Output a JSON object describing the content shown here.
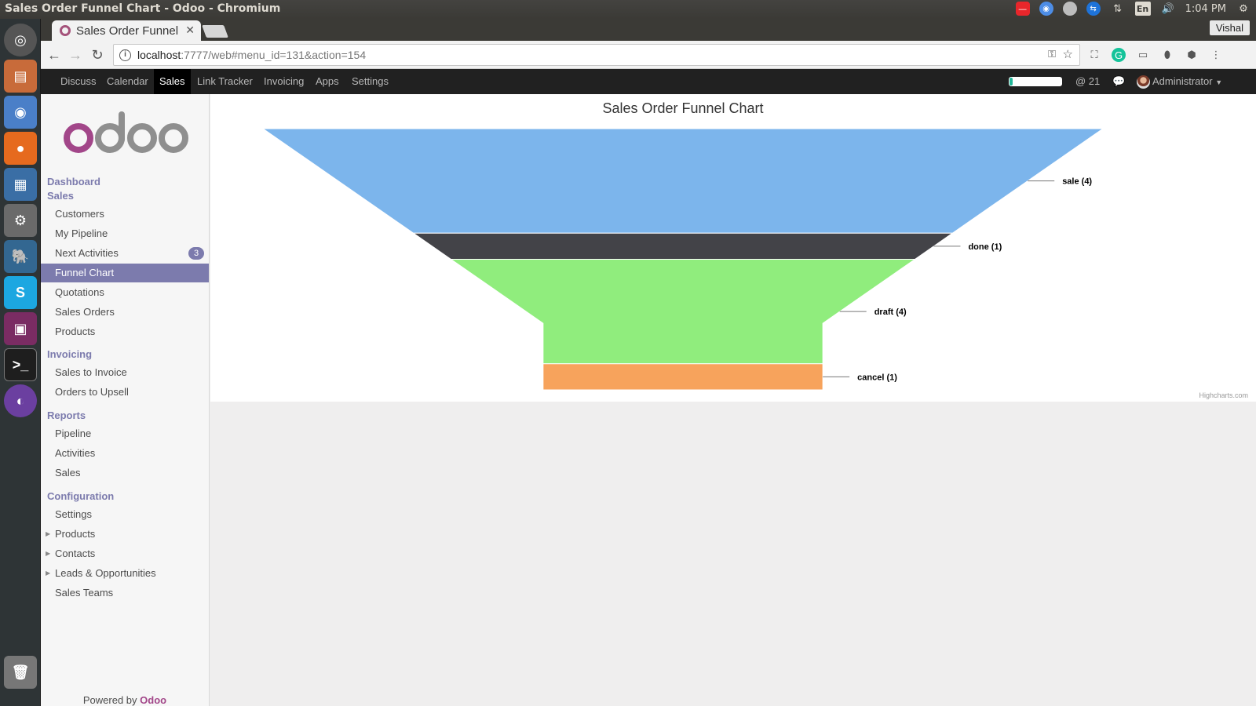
{
  "window": {
    "title": "Sales Order Funnel Chart - Odoo - Chromium"
  },
  "os_tray": {
    "lang": "En",
    "time": "1:04 PM"
  },
  "browser": {
    "tab_title": "Sales Order Funnel",
    "user": "Vishal",
    "url_host": "localhost",
    "url_path": ":7777/web#menu_id=131&action=154"
  },
  "odoo": {
    "apps": [
      "Discuss",
      "Calendar",
      "Sales",
      "Link Tracker",
      "Invoicing",
      "Apps",
      "Settings"
    ],
    "active_app": "Sales",
    "onboarding_progress_fraction": 0.06,
    "mentions": "@ 21",
    "user": "Administrator",
    "logo_text": "odoo",
    "sidebar": {
      "sections": [
        {
          "label": "Dashboard",
          "items": []
        },
        {
          "label": "Sales",
          "items": [
            {
              "label": "Customers"
            },
            {
              "label": "My Pipeline"
            },
            {
              "label": "Next Activities",
              "badge": "3"
            },
            {
              "label": "Funnel Chart",
              "active": true
            },
            {
              "label": "Quotations"
            },
            {
              "label": "Sales Orders"
            },
            {
              "label": "Products"
            }
          ]
        },
        {
          "label": "Invoicing",
          "items": [
            {
              "label": "Sales to Invoice"
            },
            {
              "label": "Orders to Upsell"
            }
          ]
        },
        {
          "label": "Reports",
          "items": [
            {
              "label": "Pipeline"
            },
            {
              "label": "Activities"
            },
            {
              "label": "Sales"
            }
          ]
        },
        {
          "label": "Configuration",
          "items": [
            {
              "label": "Settings"
            },
            {
              "label": "Products",
              "expandable": true
            },
            {
              "label": "Contacts",
              "expandable": true
            },
            {
              "label": "Leads & Opportunities",
              "expandable": true
            },
            {
              "label": "Sales Teams"
            }
          ]
        }
      ],
      "powered_by": "Powered by",
      "powered_brand": "Odoo"
    }
  },
  "chart_data": {
    "type": "funnel",
    "title": "Sales Order Funnel Chart",
    "credits": "Highcharts.com",
    "stages": [
      {
        "name": "sale",
        "value": 4,
        "label": "sale (4)",
        "color": "#7cb5ec"
      },
      {
        "name": "done",
        "value": 1,
        "label": "done (1)",
        "color": "#434348"
      },
      {
        "name": "draft",
        "value": 4,
        "label": "draft (4)",
        "color": "#90ed7d"
      },
      {
        "name": "cancel",
        "value": 1,
        "label": "cancel (1)",
        "color": "#f7a35c"
      }
    ]
  }
}
